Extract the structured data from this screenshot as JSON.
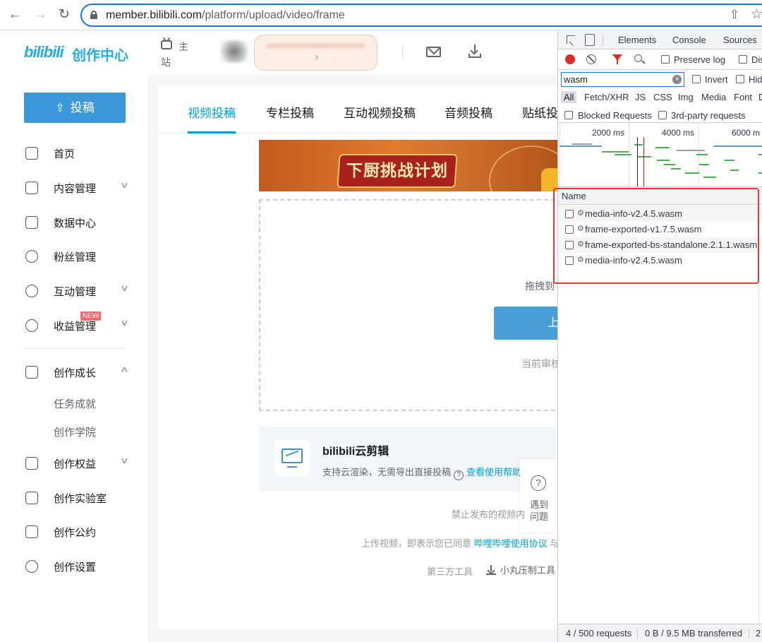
{
  "browser": {
    "url_host": "member.bilibili.com",
    "url_path": "/platform/upload/video/frame"
  },
  "header": {
    "logo_text": "bilibili",
    "logo_cn": "创作中心",
    "main_site_label": "主站"
  },
  "sidebar": {
    "post_button_label": "投稿",
    "items": [
      {
        "label": "首页",
        "icon": "home-icon"
      },
      {
        "label": "内容管理",
        "icon": "content-icon"
      },
      {
        "label": "数据中心",
        "icon": "data-icon"
      },
      {
        "label": "粉丝管理",
        "icon": "fans-icon"
      },
      {
        "label": "互动管理",
        "icon": "interaction-icon"
      },
      {
        "label": "收益管理",
        "icon": "income-icon",
        "badge": "NEW"
      },
      {
        "label": "创作成长",
        "icon": "growth-icon"
      },
      {
        "label": "创作权益",
        "icon": "flag-icon"
      },
      {
        "label": "创作实验室",
        "icon": "lab-icon"
      },
      {
        "label": "创作公约",
        "icon": "convention-icon"
      },
      {
        "label": "创作设置",
        "icon": "settings-icon"
      }
    ],
    "sub_items": [
      "任务成就",
      "创作学院"
    ]
  },
  "main": {
    "tabs": [
      "视频投稿",
      "专栏投稿",
      "互动视频投稿",
      "音频投稿",
      "贴纸投"
    ],
    "active_tab": "视频投稿",
    "banner_title": "下厨挑战计划",
    "drop_text": "拖拽到",
    "upload_button_label": "上",
    "review_text": "当前审核",
    "cloud": {
      "title": "bilibili云剪辑",
      "desc": "支持云渲染，无需导出直接投稿",
      "help_link": "查看使用帮助"
    },
    "help_float": "遇到问题",
    "ban_text": "禁止发布的视频内",
    "agree_prefix": "上传视频，即表示您已同意",
    "agree_link": "哔哩哔哩使用协议",
    "agree_suffix": "与",
    "third_tools": "第三方工具",
    "compress_tool": "小丸压制工具"
  },
  "devtools": {
    "tabs": [
      "Elements",
      "Console",
      "Sources"
    ],
    "preserve_log": "Preserve log",
    "disable_cache": "Dis",
    "filter_value": "wasm",
    "invert": "Invert",
    "hide": "Hid",
    "types": [
      "All",
      "Fetch/XHR",
      "JS",
      "CSS",
      "Img",
      "Media",
      "Font",
      "D"
    ],
    "blocked_requests": "Blocked Requests",
    "third_party": "3rd-party requests",
    "timeline_ticks": [
      "2000 ms",
      "4000 ms",
      "6000 m"
    ],
    "name_column": "Name",
    "requests": [
      "media-info-v2.4.5.wasm",
      "frame-exported-v1.7.5.wasm",
      "frame-exported-bs-standalone.2.1.1.wasm",
      "media-info-v2.4.5.wasm"
    ],
    "status_requests": "4 / 500 requests",
    "status_transferred": "0 B / 9.5 MB transferred",
    "status_extra": "2"
  },
  "colors": {
    "accent": "#00a1d6",
    "post_button": "#3b98d9",
    "highlight": "#e53935"
  }
}
